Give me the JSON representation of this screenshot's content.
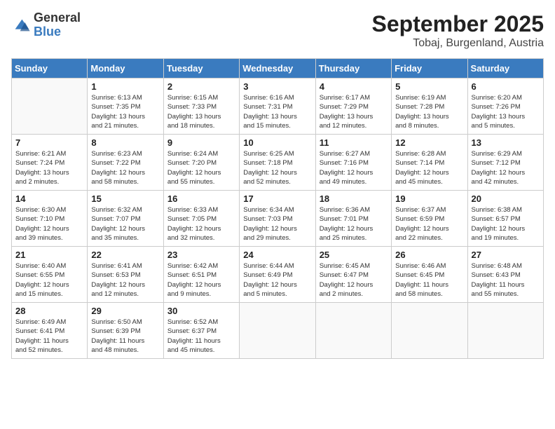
{
  "header": {
    "logo_general": "General",
    "logo_blue": "Blue",
    "month_title": "September 2025",
    "location": "Tobaj, Burgenland, Austria"
  },
  "days_of_week": [
    "Sunday",
    "Monday",
    "Tuesday",
    "Wednesday",
    "Thursday",
    "Friday",
    "Saturday"
  ],
  "weeks": [
    [
      {
        "day": "",
        "info": ""
      },
      {
        "day": "1",
        "info": "Sunrise: 6:13 AM\nSunset: 7:35 PM\nDaylight: 13 hours\nand 21 minutes."
      },
      {
        "day": "2",
        "info": "Sunrise: 6:15 AM\nSunset: 7:33 PM\nDaylight: 13 hours\nand 18 minutes."
      },
      {
        "day": "3",
        "info": "Sunrise: 6:16 AM\nSunset: 7:31 PM\nDaylight: 13 hours\nand 15 minutes."
      },
      {
        "day": "4",
        "info": "Sunrise: 6:17 AM\nSunset: 7:29 PM\nDaylight: 13 hours\nand 12 minutes."
      },
      {
        "day": "5",
        "info": "Sunrise: 6:19 AM\nSunset: 7:28 PM\nDaylight: 13 hours\nand 8 minutes."
      },
      {
        "day": "6",
        "info": "Sunrise: 6:20 AM\nSunset: 7:26 PM\nDaylight: 13 hours\nand 5 minutes."
      }
    ],
    [
      {
        "day": "7",
        "info": "Sunrise: 6:21 AM\nSunset: 7:24 PM\nDaylight: 13 hours\nand 2 minutes."
      },
      {
        "day": "8",
        "info": "Sunrise: 6:23 AM\nSunset: 7:22 PM\nDaylight: 12 hours\nand 58 minutes."
      },
      {
        "day": "9",
        "info": "Sunrise: 6:24 AM\nSunset: 7:20 PM\nDaylight: 12 hours\nand 55 minutes."
      },
      {
        "day": "10",
        "info": "Sunrise: 6:25 AM\nSunset: 7:18 PM\nDaylight: 12 hours\nand 52 minutes."
      },
      {
        "day": "11",
        "info": "Sunrise: 6:27 AM\nSunset: 7:16 PM\nDaylight: 12 hours\nand 49 minutes."
      },
      {
        "day": "12",
        "info": "Sunrise: 6:28 AM\nSunset: 7:14 PM\nDaylight: 12 hours\nand 45 minutes."
      },
      {
        "day": "13",
        "info": "Sunrise: 6:29 AM\nSunset: 7:12 PM\nDaylight: 12 hours\nand 42 minutes."
      }
    ],
    [
      {
        "day": "14",
        "info": "Sunrise: 6:30 AM\nSunset: 7:10 PM\nDaylight: 12 hours\nand 39 minutes."
      },
      {
        "day": "15",
        "info": "Sunrise: 6:32 AM\nSunset: 7:07 PM\nDaylight: 12 hours\nand 35 minutes."
      },
      {
        "day": "16",
        "info": "Sunrise: 6:33 AM\nSunset: 7:05 PM\nDaylight: 12 hours\nand 32 minutes."
      },
      {
        "day": "17",
        "info": "Sunrise: 6:34 AM\nSunset: 7:03 PM\nDaylight: 12 hours\nand 29 minutes."
      },
      {
        "day": "18",
        "info": "Sunrise: 6:36 AM\nSunset: 7:01 PM\nDaylight: 12 hours\nand 25 minutes."
      },
      {
        "day": "19",
        "info": "Sunrise: 6:37 AM\nSunset: 6:59 PM\nDaylight: 12 hours\nand 22 minutes."
      },
      {
        "day": "20",
        "info": "Sunrise: 6:38 AM\nSunset: 6:57 PM\nDaylight: 12 hours\nand 19 minutes."
      }
    ],
    [
      {
        "day": "21",
        "info": "Sunrise: 6:40 AM\nSunset: 6:55 PM\nDaylight: 12 hours\nand 15 minutes."
      },
      {
        "day": "22",
        "info": "Sunrise: 6:41 AM\nSunset: 6:53 PM\nDaylight: 12 hours\nand 12 minutes."
      },
      {
        "day": "23",
        "info": "Sunrise: 6:42 AM\nSunset: 6:51 PM\nDaylight: 12 hours\nand 9 minutes."
      },
      {
        "day": "24",
        "info": "Sunrise: 6:44 AM\nSunset: 6:49 PM\nDaylight: 12 hours\nand 5 minutes."
      },
      {
        "day": "25",
        "info": "Sunrise: 6:45 AM\nSunset: 6:47 PM\nDaylight: 12 hours\nand 2 minutes."
      },
      {
        "day": "26",
        "info": "Sunrise: 6:46 AM\nSunset: 6:45 PM\nDaylight: 11 hours\nand 58 minutes."
      },
      {
        "day": "27",
        "info": "Sunrise: 6:48 AM\nSunset: 6:43 PM\nDaylight: 11 hours\nand 55 minutes."
      }
    ],
    [
      {
        "day": "28",
        "info": "Sunrise: 6:49 AM\nSunset: 6:41 PM\nDaylight: 11 hours\nand 52 minutes."
      },
      {
        "day": "29",
        "info": "Sunrise: 6:50 AM\nSunset: 6:39 PM\nDaylight: 11 hours\nand 48 minutes."
      },
      {
        "day": "30",
        "info": "Sunrise: 6:52 AM\nSunset: 6:37 PM\nDaylight: 11 hours\nand 45 minutes."
      },
      {
        "day": "",
        "info": ""
      },
      {
        "day": "",
        "info": ""
      },
      {
        "day": "",
        "info": ""
      },
      {
        "day": "",
        "info": ""
      }
    ]
  ]
}
